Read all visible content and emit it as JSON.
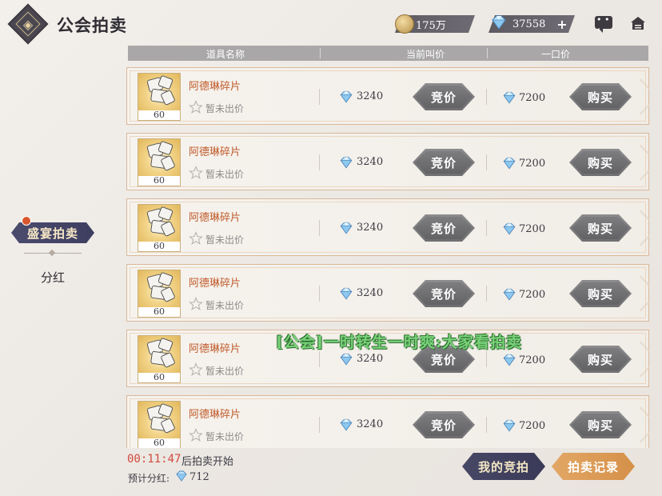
{
  "header": {
    "back_glyph": "◈",
    "title": "公会拍卖",
    "gold_amount": "175万",
    "gem_amount": "37558",
    "plus_label": "+"
  },
  "sidebar": {
    "items": [
      {
        "label": "盛宴拍卖",
        "active": true,
        "badge": true
      },
      {
        "label": "分红",
        "active": false
      }
    ]
  },
  "table": {
    "headers": [
      "道具名称",
      "当前叫价",
      "一口价"
    ],
    "rows": [
      {
        "name": "阿德琳碎片",
        "qty": "60",
        "status": "暂未出价",
        "current_bid": "3240",
        "bid_label": "竞价",
        "buyout": "7200",
        "buy_label": "购买"
      },
      {
        "name": "阿德琳碎片",
        "qty": "60",
        "status": "暂未出价",
        "current_bid": "3240",
        "bid_label": "竞价",
        "buyout": "7200",
        "buy_label": "购买"
      },
      {
        "name": "阿德琳碎片",
        "qty": "60",
        "status": "暂未出价",
        "current_bid": "3240",
        "bid_label": "竞价",
        "buyout": "7200",
        "buy_label": "购买"
      },
      {
        "name": "阿德琳碎片",
        "qty": "60",
        "status": "暂未出价",
        "current_bid": "3240",
        "bid_label": "竞价",
        "buyout": "7200",
        "buy_label": "购买"
      },
      {
        "name": "阿德琳碎片",
        "qty": "60",
        "status": "暂未出价",
        "current_bid": "3240",
        "bid_label": "竞价",
        "buyout": "7200",
        "buy_label": "购买"
      },
      {
        "name": "阿德琳碎片",
        "qty": "60",
        "status": "暂未出价",
        "current_bid": "3240",
        "bid_label": "竞价",
        "buyout": "7200",
        "buy_label": "购买"
      }
    ]
  },
  "chat_ticker": "[公会]一时转生一时爽:大家看拍卖",
  "footer": {
    "countdown": "00:11:47",
    "countdown_suffix": "后拍卖开始",
    "dividend_label": "预计分红:",
    "dividend_value": "712",
    "my_bids_label": "我的竞拍",
    "records_label": "拍卖记录"
  },
  "colors": {
    "accent_navy": "#3e3e61",
    "accent_orange": "#d59049",
    "item_name": "#c05a2a",
    "countdown": "#d24a3f",
    "chat_green": "#79d27a"
  },
  "icons": {
    "back": "back-diamond-icon",
    "gold": "coin-icon",
    "gem": "diamond-gem-icon",
    "chat": "chat-bubble-icon",
    "home": "home-icon",
    "star": "star-outline-icon"
  }
}
